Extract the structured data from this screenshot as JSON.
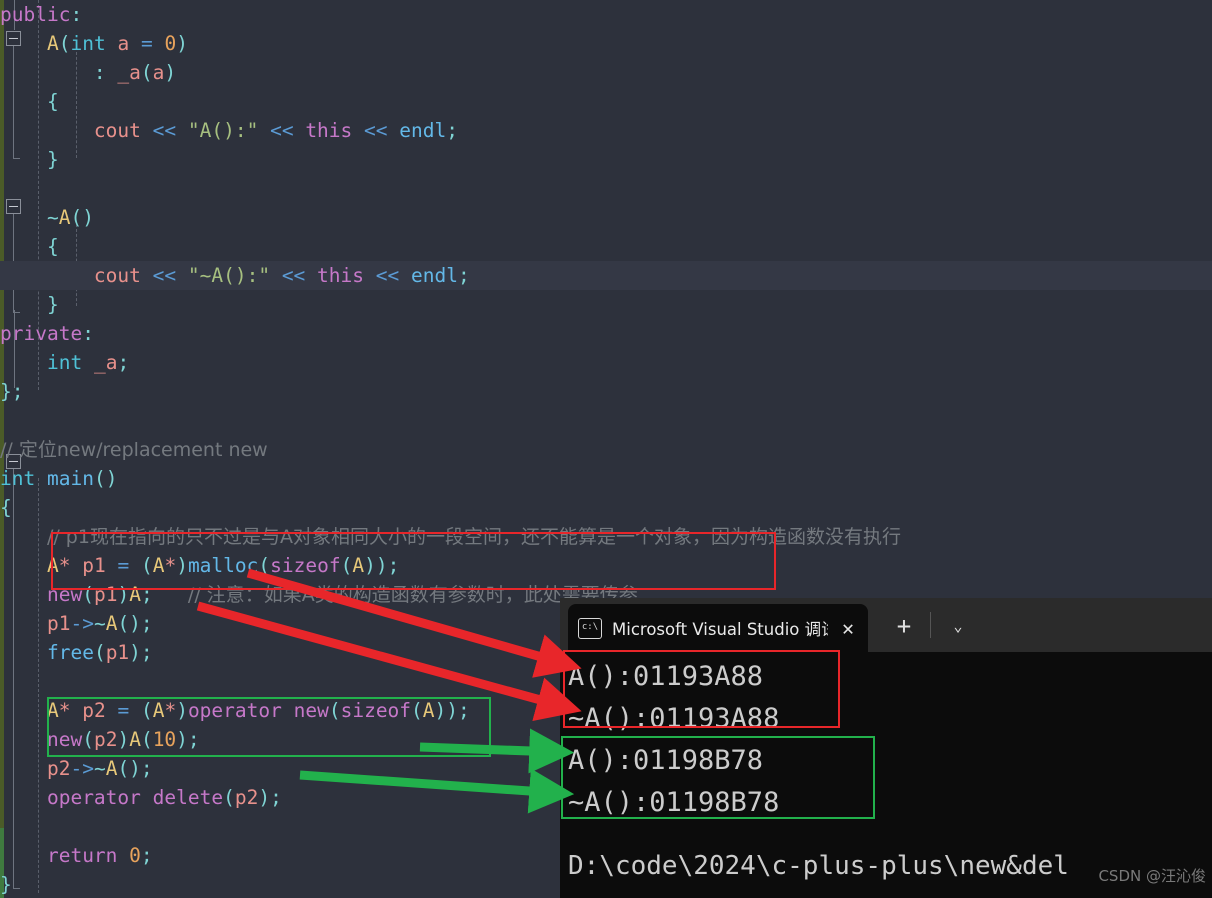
{
  "editor": {
    "background": "#2d313c",
    "lines": [
      {
        "indent": 0,
        "tokens": [
          {
            "t": "public",
            "c": "kw"
          },
          {
            "t": ":",
            "c": "punc"
          }
        ]
      },
      {
        "indent": 0,
        "tokens": [
          {
            "t": "    ",
            "c": "ident"
          },
          {
            "t": "A",
            "c": "cls"
          },
          {
            "t": "(",
            "c": "punc"
          },
          {
            "t": "int",
            "c": "type"
          },
          {
            "t": " ",
            "c": "ident"
          },
          {
            "t": "a",
            "c": "var"
          },
          {
            "t": " = ",
            "c": "op"
          },
          {
            "t": "0",
            "c": "num"
          },
          {
            "t": ")",
            "c": "punc"
          }
        ]
      },
      {
        "indent": 0,
        "tokens": [
          {
            "t": "        : ",
            "c": "punc"
          },
          {
            "t": "_a",
            "c": "var"
          },
          {
            "t": "(",
            "c": "punc"
          },
          {
            "t": "a",
            "c": "var"
          },
          {
            "t": ")",
            "c": "punc"
          }
        ]
      },
      {
        "indent": 0,
        "tokens": [
          {
            "t": "    {",
            "c": "punc"
          }
        ]
      },
      {
        "indent": 0,
        "tokens": [
          {
            "t": "        ",
            "c": "ident"
          },
          {
            "t": "cout",
            "c": "var"
          },
          {
            "t": " ",
            "c": "ident"
          },
          {
            "t": "<<",
            "c": "op"
          },
          {
            "t": " ",
            "c": "ident"
          },
          {
            "t": "\"A():\"",
            "c": "str"
          },
          {
            "t": " ",
            "c": "ident"
          },
          {
            "t": "<<",
            "c": "op"
          },
          {
            "t": " ",
            "c": "ident"
          },
          {
            "t": "this",
            "c": "kw"
          },
          {
            "t": " ",
            "c": "ident"
          },
          {
            "t": "<<",
            "c": "op"
          },
          {
            "t": " ",
            "c": "ident"
          },
          {
            "t": "endl",
            "c": "fn"
          },
          {
            "t": ";",
            "c": "semi"
          }
        ]
      },
      {
        "indent": 0,
        "tokens": [
          {
            "t": "    }",
            "c": "punc"
          }
        ]
      },
      {
        "indent": 0,
        "tokens": []
      },
      {
        "indent": 0,
        "tokens": [
          {
            "t": "    ~",
            "c": "punc"
          },
          {
            "t": "A",
            "c": "cls"
          },
          {
            "t": "()",
            "c": "punc"
          }
        ]
      },
      {
        "indent": 0,
        "tokens": [
          {
            "t": "    {",
            "c": "punc"
          }
        ]
      },
      {
        "indent": 0,
        "highlight": true,
        "tokens": [
          {
            "t": "        ",
            "c": "ident"
          },
          {
            "t": "cout",
            "c": "var"
          },
          {
            "t": " ",
            "c": "ident"
          },
          {
            "t": "<<",
            "c": "op"
          },
          {
            "t": " ",
            "c": "ident"
          },
          {
            "t": "\"~A():\"",
            "c": "str"
          },
          {
            "t": " ",
            "c": "ident"
          },
          {
            "t": "<<",
            "c": "op"
          },
          {
            "t": " ",
            "c": "ident"
          },
          {
            "t": "this",
            "c": "kw"
          },
          {
            "t": " ",
            "c": "ident"
          },
          {
            "t": "<<",
            "c": "op"
          },
          {
            "t": " ",
            "c": "ident"
          },
          {
            "t": "endl",
            "c": "fn"
          },
          {
            "t": ";",
            "c": "semi"
          }
        ]
      },
      {
        "indent": 0,
        "tokens": [
          {
            "t": "    }",
            "c": "punc"
          }
        ]
      },
      {
        "indent": 0,
        "tokens": [
          {
            "t": "private",
            "c": "kw"
          },
          {
            "t": ":",
            "c": "punc"
          }
        ]
      },
      {
        "indent": 0,
        "tokens": [
          {
            "t": "    ",
            "c": "ident"
          },
          {
            "t": "int",
            "c": "type"
          },
          {
            "t": " ",
            "c": "ident"
          },
          {
            "t": "_a",
            "c": "var"
          },
          {
            "t": ";",
            "c": "semi"
          }
        ]
      },
      {
        "indent": 0,
        "tokens": [
          {
            "t": "};",
            "c": "punc"
          }
        ]
      },
      {
        "indent": 0,
        "tokens": []
      },
      {
        "indent": 0,
        "tokens": [
          {
            "t": "// 定位new/replacement new",
            "c": "cmtcn"
          }
        ]
      },
      {
        "indent": 0,
        "tokens": [
          {
            "t": "int",
            "c": "type"
          },
          {
            "t": " ",
            "c": "ident"
          },
          {
            "t": "main",
            "c": "fn"
          },
          {
            "t": "()",
            "c": "punc"
          }
        ]
      },
      {
        "indent": 0,
        "tokens": [
          {
            "t": "{",
            "c": "punc"
          }
        ]
      },
      {
        "indent": 0,
        "tokens": [
          {
            "t": "    ",
            "c": "ident"
          },
          {
            "t": "// p1现在指向的只不过是与A对象相同大小的一段空间，还不能算是一个对象，因为构造函数没有执行",
            "c": "cmtcn"
          }
        ]
      },
      {
        "indent": 0,
        "tokens": [
          {
            "t": "    ",
            "c": "ident"
          },
          {
            "t": "A",
            "c": "cls"
          },
          {
            "t": "*",
            "c": "star"
          },
          {
            "t": " ",
            "c": "ident"
          },
          {
            "t": "p1",
            "c": "var"
          },
          {
            "t": " = ",
            "c": "op"
          },
          {
            "t": "(",
            "c": "punc"
          },
          {
            "t": "A",
            "c": "cls"
          },
          {
            "t": "*",
            "c": "star"
          },
          {
            "t": ")",
            "c": "punc"
          },
          {
            "t": "malloc",
            "c": "fn"
          },
          {
            "t": "(",
            "c": "punc"
          },
          {
            "t": "sizeof",
            "c": "kw"
          },
          {
            "t": "(",
            "c": "punc"
          },
          {
            "t": "A",
            "c": "cls"
          },
          {
            "t": "))",
            "c": "punc"
          },
          {
            "t": ";",
            "c": "semi"
          }
        ]
      },
      {
        "indent": 0,
        "tokens": [
          {
            "t": "    ",
            "c": "ident"
          },
          {
            "t": "new",
            "c": "kw"
          },
          {
            "t": "(",
            "c": "punc"
          },
          {
            "t": "p1",
            "c": "var"
          },
          {
            "t": ")",
            "c": "punc"
          },
          {
            "t": "A",
            "c": "cls"
          },
          {
            "t": ";",
            "c": "semi"
          },
          {
            "t": "   ",
            "c": "ident"
          },
          {
            "t": "// 注意：如果A类的构造函数有参数时，此处需要传参",
            "c": "cmtcn"
          }
        ]
      },
      {
        "indent": 0,
        "tokens": [
          {
            "t": "    ",
            "c": "ident"
          },
          {
            "t": "p1",
            "c": "var"
          },
          {
            "t": "->",
            "c": "op"
          },
          {
            "t": "~",
            "c": "punc"
          },
          {
            "t": "A",
            "c": "cls"
          },
          {
            "t": "()",
            "c": "punc"
          },
          {
            "t": ";",
            "c": "semi"
          }
        ]
      },
      {
        "indent": 0,
        "tokens": [
          {
            "t": "    ",
            "c": "ident"
          },
          {
            "t": "free",
            "c": "fn"
          },
          {
            "t": "(",
            "c": "punc"
          },
          {
            "t": "p1",
            "c": "var"
          },
          {
            "t": ")",
            "c": "punc"
          },
          {
            "t": ";",
            "c": "semi"
          }
        ]
      },
      {
        "indent": 0,
        "tokens": []
      },
      {
        "indent": 0,
        "tokens": [
          {
            "t": "    ",
            "c": "ident"
          },
          {
            "t": "A",
            "c": "cls"
          },
          {
            "t": "*",
            "c": "star"
          },
          {
            "t": " ",
            "c": "ident"
          },
          {
            "t": "p2",
            "c": "var"
          },
          {
            "t": " = ",
            "c": "op"
          },
          {
            "t": "(",
            "c": "punc"
          },
          {
            "t": "A",
            "c": "cls"
          },
          {
            "t": "*",
            "c": "star"
          },
          {
            "t": ")",
            "c": "punc"
          },
          {
            "t": "operator",
            "c": "kw"
          },
          {
            "t": " ",
            "c": "ident"
          },
          {
            "t": "new",
            "c": "kw"
          },
          {
            "t": "(",
            "c": "punc"
          },
          {
            "t": "sizeof",
            "c": "kw"
          },
          {
            "t": "(",
            "c": "punc"
          },
          {
            "t": "A",
            "c": "cls"
          },
          {
            "t": "))",
            "c": "punc"
          },
          {
            "t": ";",
            "c": "semi"
          }
        ]
      },
      {
        "indent": 0,
        "tokens": [
          {
            "t": "    ",
            "c": "ident"
          },
          {
            "t": "new",
            "c": "kw"
          },
          {
            "t": "(",
            "c": "punc"
          },
          {
            "t": "p2",
            "c": "var"
          },
          {
            "t": ")",
            "c": "punc"
          },
          {
            "t": "A",
            "c": "cls"
          },
          {
            "t": "(",
            "c": "punc"
          },
          {
            "t": "10",
            "c": "num"
          },
          {
            "t": ")",
            "c": "punc"
          },
          {
            "t": ";",
            "c": "semi"
          }
        ]
      },
      {
        "indent": 0,
        "tokens": [
          {
            "t": "    ",
            "c": "ident"
          },
          {
            "t": "p2",
            "c": "var"
          },
          {
            "t": "->",
            "c": "op"
          },
          {
            "t": "~",
            "c": "punc"
          },
          {
            "t": "A",
            "c": "cls"
          },
          {
            "t": "()",
            "c": "punc"
          },
          {
            "t": ";",
            "c": "semi"
          }
        ]
      },
      {
        "indent": 0,
        "tokens": [
          {
            "t": "    ",
            "c": "ident"
          },
          {
            "t": "operator",
            "c": "kw"
          },
          {
            "t": " ",
            "c": "ident"
          },
          {
            "t": "delete",
            "c": "kw"
          },
          {
            "t": "(",
            "c": "punc"
          },
          {
            "t": "p2",
            "c": "var"
          },
          {
            "t": ")",
            "c": "punc"
          },
          {
            "t": ";",
            "c": "semi"
          }
        ]
      },
      {
        "indent": 0,
        "tokens": []
      },
      {
        "indent": 0,
        "tokens": [
          {
            "t": "    ",
            "c": "ident"
          },
          {
            "t": "return",
            "c": "kw"
          },
          {
            "t": " ",
            "c": "ident"
          },
          {
            "t": "0",
            "c": "num"
          },
          {
            "t": ";",
            "c": "semi"
          }
        ]
      },
      {
        "indent": 0,
        "tokens": [
          {
            "t": "}",
            "c": "punc"
          }
        ]
      }
    ]
  },
  "annotations": {
    "red_color": "#e8262a",
    "green_color": "#22b14c",
    "red_code_box_label": "malloc-placement-new-block",
    "green_code_box_label": "operator-new-placement-new-block",
    "red_output_box_label": "malloc-output-block",
    "green_output_box_label": "operator-new-output-block"
  },
  "terminal": {
    "tab_title": "Microsoft Visual Studio 调试控",
    "tab_icon": "console-icon",
    "close_label": "✕",
    "new_tab_label": "+",
    "dropdown_label": "⌄",
    "output_lines": [
      "A():01193A88",
      "~A():01193A88",
      "A():01198B78",
      "~A():01198B78"
    ],
    "path_line": "D:\\code\\2024\\c-plus-plus\\new&del"
  },
  "watermark": "CSDN @汪沁俊"
}
